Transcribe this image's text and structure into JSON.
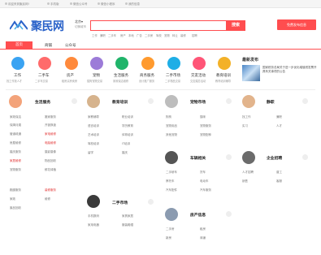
{
  "topbar": {
    "items": [
      "欢迎来到聚民网!",
      "手机版",
      "微信公众号",
      "微信小程序",
      "我的信息"
    ]
  },
  "brand": {
    "logo_text": "聚民网",
    "city": "北京▾",
    "city_sub": "切换城市"
  },
  "search": {
    "placeholder": "",
    "button": "搜索",
    "hot": [
      "工作",
      "兼职",
      "二手车",
      "房产",
      "本地",
      "广告",
      "二手房",
      "驾校",
      "宠物",
      "转让",
      "装修",
      "招聘"
    ]
  },
  "publish_button": "免费发布信息",
  "nav": {
    "active": "首页",
    "items": [
      "商铺",
      "公众号"
    ]
  },
  "categories": [
    {
      "title": "工作",
      "sub": "找工作找人才",
      "color": "#3aa3f2",
      "glyph": "工"
    },
    {
      "title": "二手车",
      "sub": "二手车交易",
      "color": "#ff6b6b",
      "glyph": "车"
    },
    {
      "title": "房产",
      "sub": "租房买房卖房",
      "color": "#ff8a3c",
      "glyph": "房"
    },
    {
      "title": "宠物",
      "sub": "猫狗宠物交易",
      "color": "#9c7bd8",
      "glyph": "宠"
    },
    {
      "title": "生活服务",
      "sub": "家政保洁维修",
      "color": "#20b46a",
      "glyph": "生"
    },
    {
      "title": "商务服务",
      "sub": "设计推广服务",
      "color": "#ff9a2e",
      "glyph": "商"
    },
    {
      "title": "二手市场",
      "sub": "二手物品交易",
      "color": "#1eaee6",
      "glyph": "二"
    },
    {
      "title": "交友活动",
      "sub": "交友婚恋活动",
      "color": "#ff5577",
      "glyph": "友"
    },
    {
      "title": "教育培训",
      "sub": "教育培训辅导",
      "color": "#f3b128",
      "glyph": "教"
    }
  ],
  "news": {
    "title": "最新发布",
    "text": "国家税务总局关于进一步优化增值税发票开具有关事项的公告"
  },
  "sections": {
    "life": {
      "title": "生活服务",
      "items": [
        "家政保洁",
        "搬家服务",
        "保姆月嫂",
        "开锁换锁",
        "管道疏通",
        "家电维修",
        "房屋维修",
        "电脑维修",
        "婚庆服务",
        "摄影摄像",
        "家居维修",
        "物品回收",
        "宠物服务",
        "鲜花绿植",
        "跑腿服务",
        "装修服务",
        "家政",
        "维修",
        "废品回收"
      ]
    },
    "edu": {
      "title": "教育培训",
      "items": [
        "家教辅导",
        "职业培训",
        "语言培训",
        "学历教育",
        "艺术培训",
        "体育培训",
        "驾校培训",
        "IT培训",
        "留学",
        "婚庆"
      ]
    },
    "pet": {
      "title": "宠物市场",
      "items": [
        "狗狗",
        "猫咪",
        "宠物用品",
        "宠物服务",
        "其他宠物",
        "宠物配种"
      ]
    },
    "car": {
      "title": "车辆相关",
      "items": [
        "二手轿车",
        "货车",
        "摩托车",
        "电动车",
        "汽车配件",
        "汽车服务"
      ]
    },
    "job": {
      "title": "静职",
      "items": [
        "找工作",
        "兼职",
        "实习",
        "人才"
      ]
    },
    "corp": {
      "title": "企业招聘",
      "items": [
        "人才招聘",
        "普工",
        "销售",
        "客服"
      ]
    },
    "secondhand": {
      "title": "二手市场",
      "items": [
        "手机数码",
        "家具家居",
        "家用电器",
        "服装鞋帽"
      ]
    },
    "house": {
      "title": "房产信息",
      "items": [
        "二手房",
        "租房",
        "新房",
        "商铺"
      ]
    }
  }
}
